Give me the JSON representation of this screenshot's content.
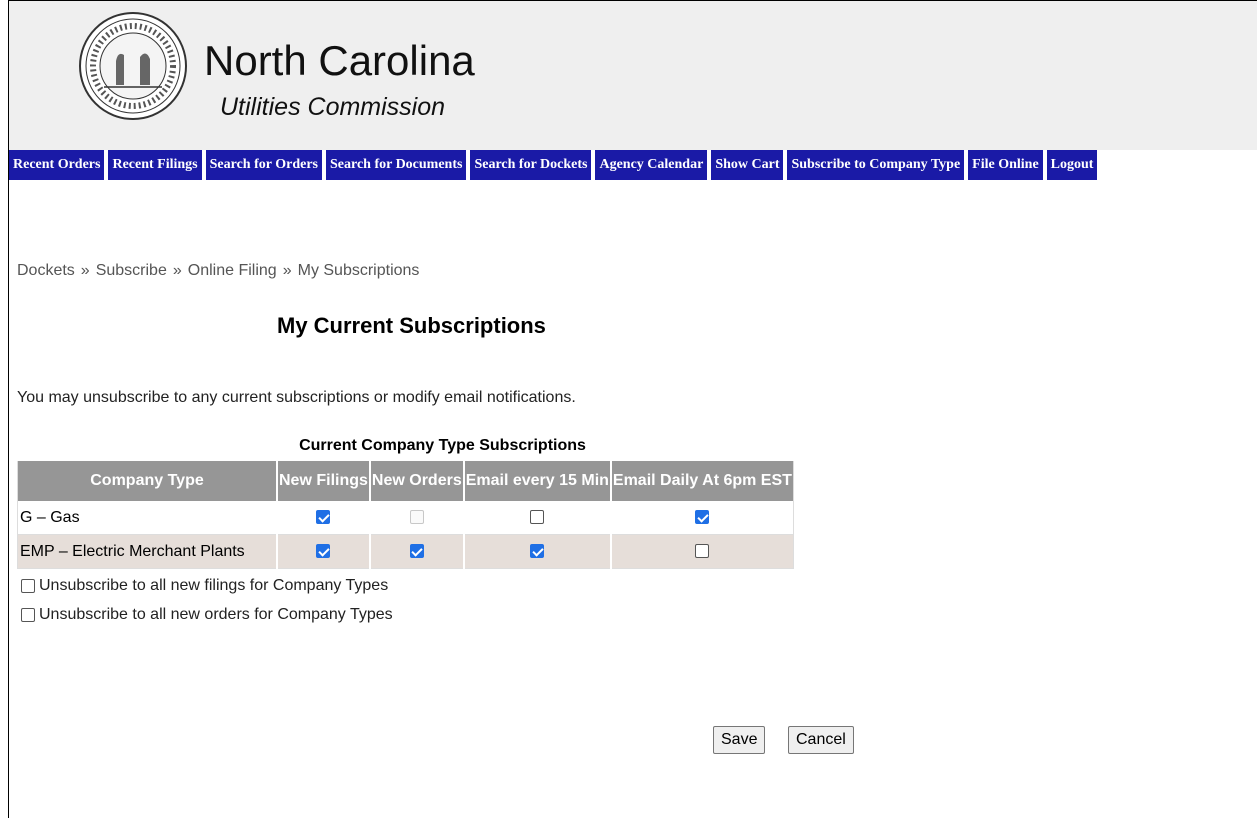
{
  "header": {
    "title": "North Carolina",
    "subtitle": "Utilities Commission",
    "seal_icon": "state-seal-icon"
  },
  "nav": [
    {
      "label": "Recent Orders"
    },
    {
      "label": "Recent Filings"
    },
    {
      "label": "Search for Orders"
    },
    {
      "label": "Search for Documents"
    },
    {
      "label": "Search for Dockets"
    },
    {
      "label": "Agency Calendar"
    },
    {
      "label": "Show Cart"
    },
    {
      "label": "Subscribe to Company Type"
    },
    {
      "label": "File Online"
    },
    {
      "label": "Logout"
    }
  ],
  "colors": {
    "nav_bg": "#1a1aa6",
    "header_bg": "#efefef",
    "table_header_bg": "#969696",
    "row_alt_bg": "#e6ded9",
    "checkbox_checked": "#1f6fe5"
  },
  "breadcrumb": {
    "items": [
      "Dockets",
      "Subscribe",
      "Online Filing",
      "My Subscriptions"
    ],
    "separator": "»"
  },
  "page_title": "My Current Subscriptions",
  "intro_text": "You may unsubscribe to any current subscriptions or modify email notifications.",
  "table": {
    "caption": "Current Company Type Subscriptions",
    "columns": [
      "Company Type",
      "New Filings",
      "New Orders",
      "Email every 15 Min",
      "Email Daily At 6pm EST"
    ],
    "rows": [
      {
        "company_type": "G – Gas",
        "new_filings": "checked",
        "new_orders": "disabled",
        "email_15min": "unchecked",
        "email_daily": "checked"
      },
      {
        "company_type": "EMP – Electric Merchant Plants",
        "new_filings": "checked",
        "new_orders": "checked",
        "email_15min": "checked",
        "email_daily": "unchecked"
      }
    ]
  },
  "options": {
    "unsub_filings": {
      "label": "Unsubscribe to all new filings for Company Types",
      "state": "unchecked"
    },
    "unsub_orders": {
      "label": "Unsubscribe to all new orders for Company Types",
      "state": "unchecked"
    }
  },
  "buttons": {
    "save": "Save",
    "cancel": "Cancel"
  }
}
